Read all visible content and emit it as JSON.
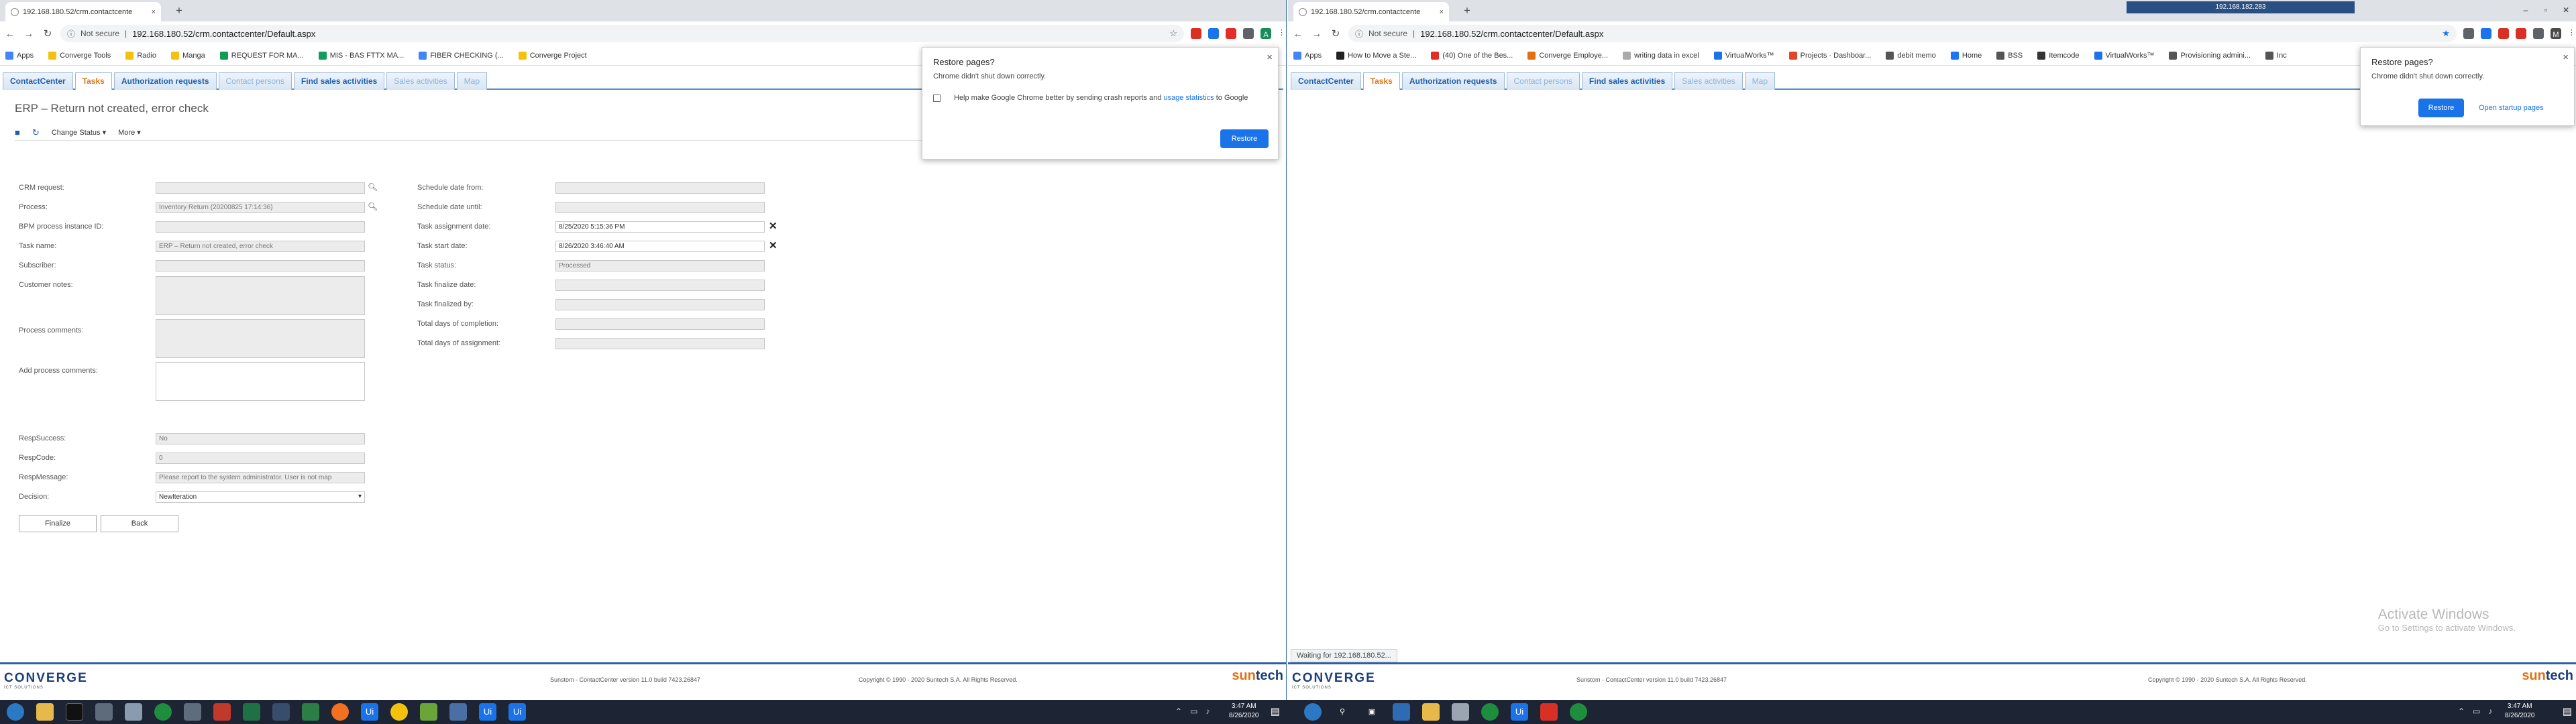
{
  "left_browser": {
    "tab_title": "192.168.180.52/crm.contactcente",
    "tab_close": "×",
    "newtab": "+",
    "not_secure": "Not secure",
    "url": "192.168.180.52/crm.contactcenter/Default.aspx",
    "avatar_letter": "A",
    "bookmarks": [
      "Apps",
      "Converge Tools",
      "Radio",
      "Manga",
      "REQUEST FOR MA...",
      "MIS - BAS FTTX MA...",
      "FIBER CHECKING (...",
      "Converge Project"
    ],
    "restore_popup": {
      "title": "Restore pages?",
      "message": "Chrome didn't shut down correctly.",
      "checkbox_text": "Help make Google Chrome better by sending crash reports and",
      "link_text": "usage statistics",
      "suffix": "to Google",
      "restore_button": "Restore",
      "close": "×"
    }
  },
  "crm": {
    "tabs": [
      "ContactCenter",
      "Tasks",
      "Authorization requests",
      "Contact persons",
      "Find sales activities",
      "Sales activities",
      "Map"
    ],
    "page_title": "ERP – Return not created, error check",
    "toolbar": {
      "change_status": "Change Status ▾",
      "more": "More ▾"
    },
    "left_fields": {
      "crm_request": {
        "label": "CRM request:",
        "value": ""
      },
      "process": {
        "label": "Process:",
        "value": "Inventory Return (20200825 17:14:36)"
      },
      "bpm_id": {
        "label": "BPM process instance ID:",
        "value": ""
      },
      "task_name": {
        "label": "Task name:",
        "value": "ERP – Return not created, error check"
      },
      "subscriber": {
        "label": "Subscriber:",
        "value": ""
      },
      "customer_notes": {
        "label": "Customer notes:",
        "value": ""
      },
      "process_comments": {
        "label": "Process comments:",
        "value": ""
      },
      "add_process_comments": {
        "label": "Add process comments:",
        "value": ""
      }
    },
    "resp_fields": {
      "resp_success": {
        "label": "RespSuccess:",
        "value": "No"
      },
      "resp_code": {
        "label": "RespCode:",
        "value": "0"
      },
      "resp_message": {
        "label": "RespMessage:",
        "value": "Please report to the system administrator. User is not map"
      },
      "decision": {
        "label": "Decision:",
        "value": "NewIteration"
      }
    },
    "right_fields": {
      "schedule_from": {
        "label": "Schedule date from:",
        "value": ""
      },
      "schedule_until": {
        "label": "Schedule date until:",
        "value": ""
      },
      "assignment_date": {
        "label": "Task assignment date:",
        "value": "8/25/2020 5:15:36 PM"
      },
      "start_date": {
        "label": "Task start date:",
        "value": "8/26/2020 3:46:40 AM"
      },
      "status": {
        "label": "Task status:",
        "value": "Processed"
      },
      "finalize_date": {
        "label": "Task finalize date:",
        "value": ""
      },
      "finalized_by": {
        "label": "Task finalized by:",
        "value": ""
      },
      "days_completion": {
        "label": "Total days of completion:",
        "value": ""
      },
      "days_assignment": {
        "label": "Total days of assignment:",
        "value": ""
      }
    },
    "buttons": {
      "finalize": "Finalize",
      "back": "Back"
    },
    "footer": {
      "logo": "CONVERGE",
      "logo_sub": "ICT SOLUTIONS",
      "version": "Sunstom - ContactCenter version 11.0 build 7423.26847",
      "copyright": "Copyright © 1990 - 2020 Suntech S.A. All Rights Reserved.",
      "brand_a": "sun",
      "brand_b": "tech"
    }
  },
  "right_browser": {
    "tab_title": "192.168.180.52/crm.contactcente",
    "tab_close": "×",
    "newtab": "+",
    "title_ip": "192.168.182.283",
    "not_secure": "Not secure",
    "url": "192.168.180.52/crm.contactcenter/Default.aspx",
    "avatar_letter": "M",
    "bookmarks": [
      "Apps",
      "How to Move a Ste...",
      "(40) One of the Bes...",
      "Converge Employe...",
      "writing data in excel",
      "VirtualWorks™",
      "Projects · Dashboar...",
      "debit memo",
      "Home",
      "BSS",
      "Itemcode",
      "VirtualWorks™",
      "Provisioning admini...",
      "Inc"
    ],
    "restore_popup": {
      "title": "Restore pages?",
      "message": "Chrome didn't shut down correctly.",
      "restore_button": "Restore",
      "open_startup": "Open startup pages",
      "close": "×"
    },
    "status_text": "Waiting for 192.168.180.52...",
    "activate_title": "Activate Windows",
    "activate_sub": "Go to Settings to activate Windows."
  },
  "taskbar": {
    "time": "3:47 AM",
    "date": "8/26/2020",
    "app_labels": [
      "Ui",
      "Ui",
      "Ui",
      "Ui"
    ]
  },
  "colors": {
    "accent": "#1f5faa",
    "active_tab": "#e0781c",
    "chrome_blue": "#1a73e8",
    "taskbar": "#1d2433"
  }
}
